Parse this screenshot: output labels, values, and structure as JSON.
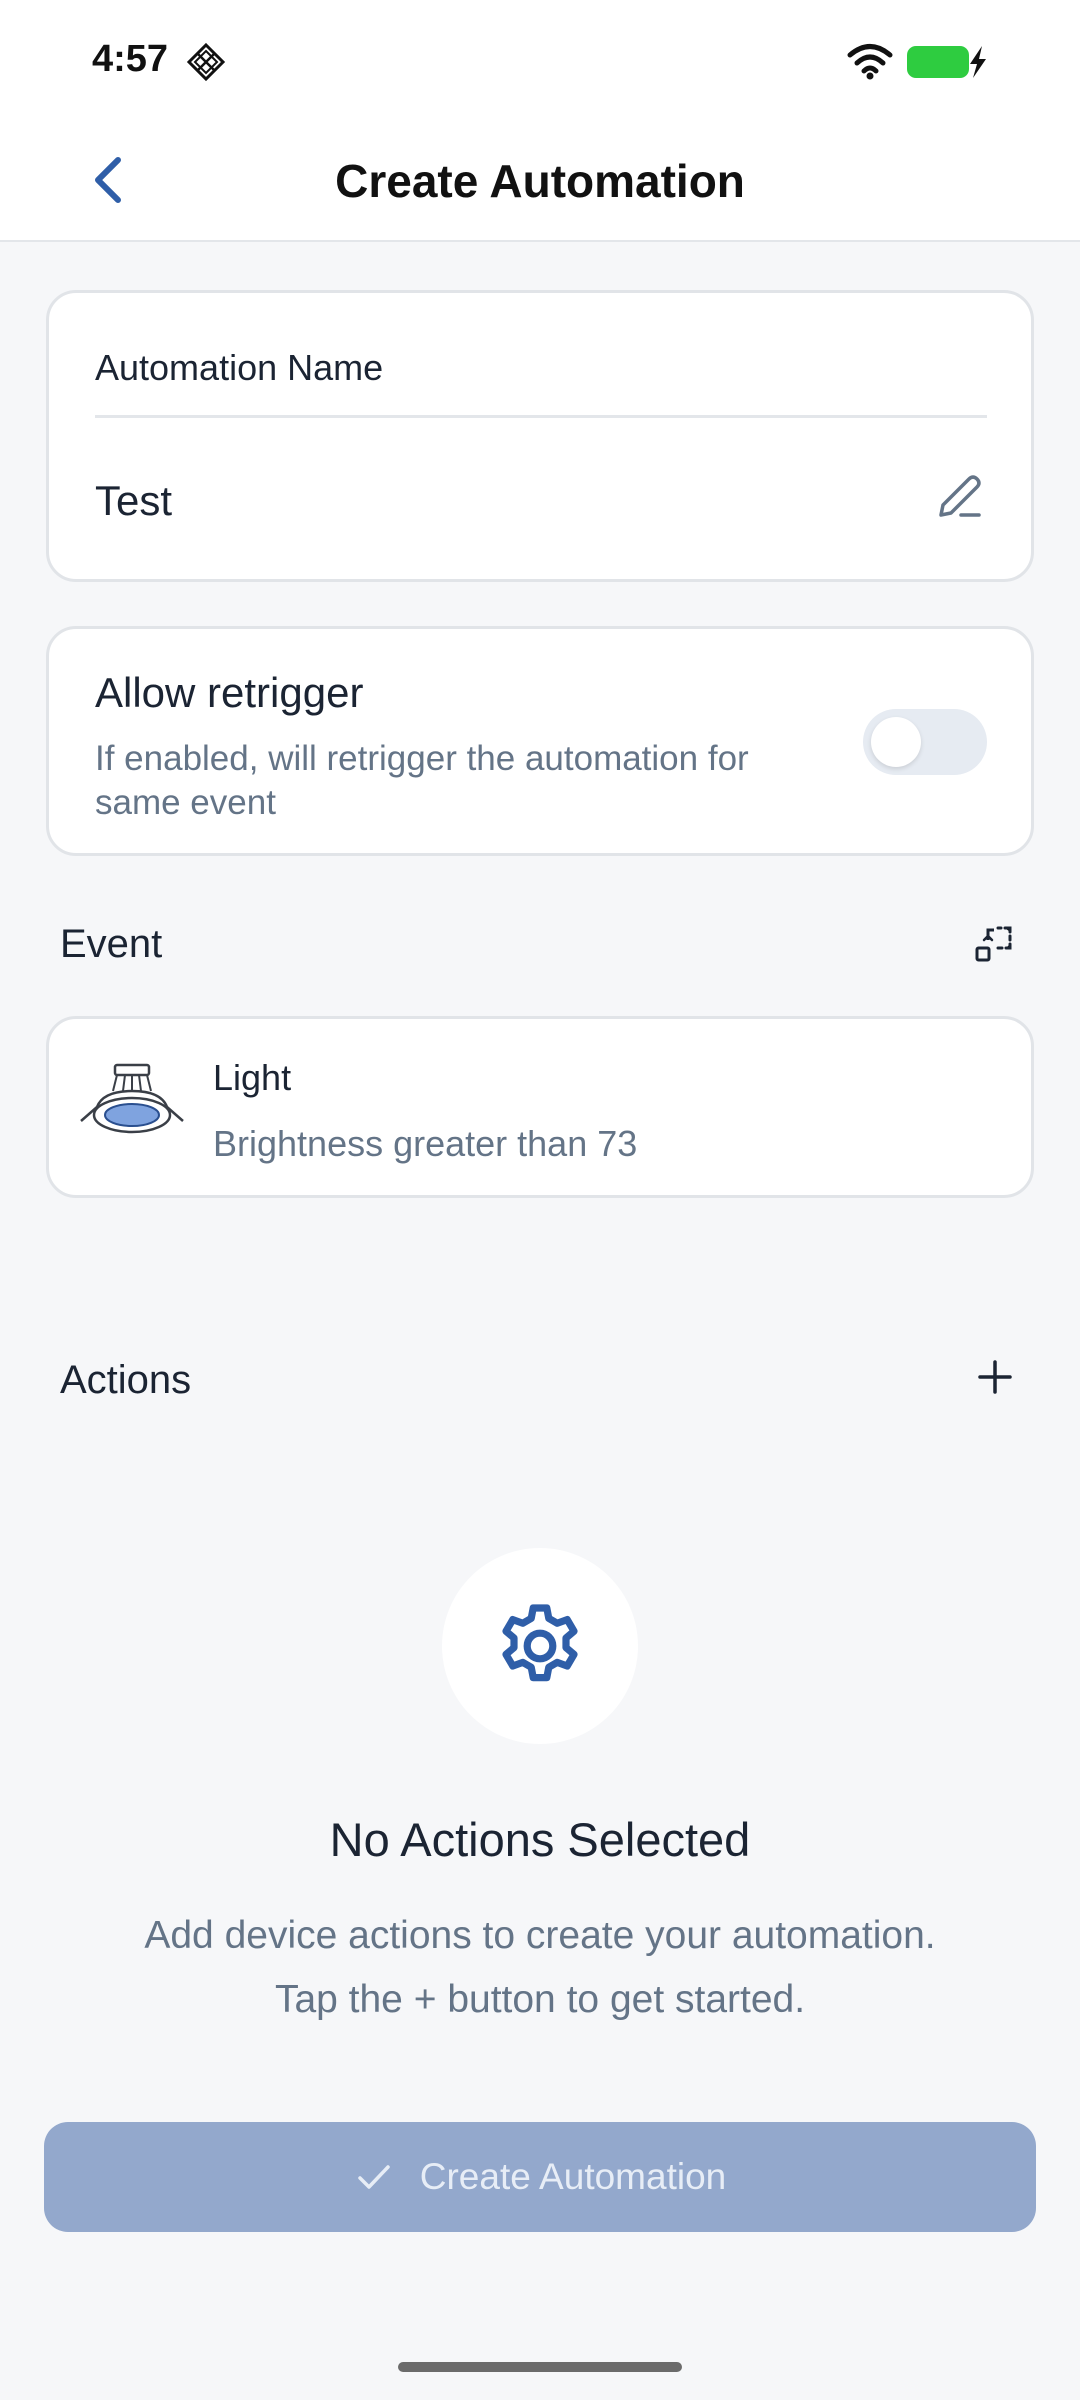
{
  "status_bar": {
    "time": "4:57",
    "icons": [
      "diamond-grid-icon",
      "wifi-icon",
      "battery-charging-icon"
    ],
    "battery_color": "#2ecc40"
  },
  "nav": {
    "title": "Create Automation",
    "back_icon": "chevron-left-icon",
    "accent_color": "#2f5ea8"
  },
  "name_card": {
    "label": "Automation Name",
    "value": "Test",
    "icon": "pencil-icon"
  },
  "retrigger_card": {
    "title": "Allow retrigger",
    "description": "If enabled, will retrigger the automation for same event",
    "enabled": false
  },
  "event_section": {
    "label": "Event",
    "icon": "edit-selection-icon",
    "item": {
      "device": "Light",
      "condition": "Brightness greater than 73",
      "icon": "ceiling-light-icon"
    }
  },
  "actions_section": {
    "label": "Actions",
    "icon": "plus-icon",
    "empty_icon": "gear-icon",
    "empty_title": "No Actions Selected",
    "empty_description": "Add device actions to create your automation. Tap the + button to get started."
  },
  "create_button": {
    "label": "Create Automation",
    "icon": "check-icon",
    "disabled": true
  }
}
